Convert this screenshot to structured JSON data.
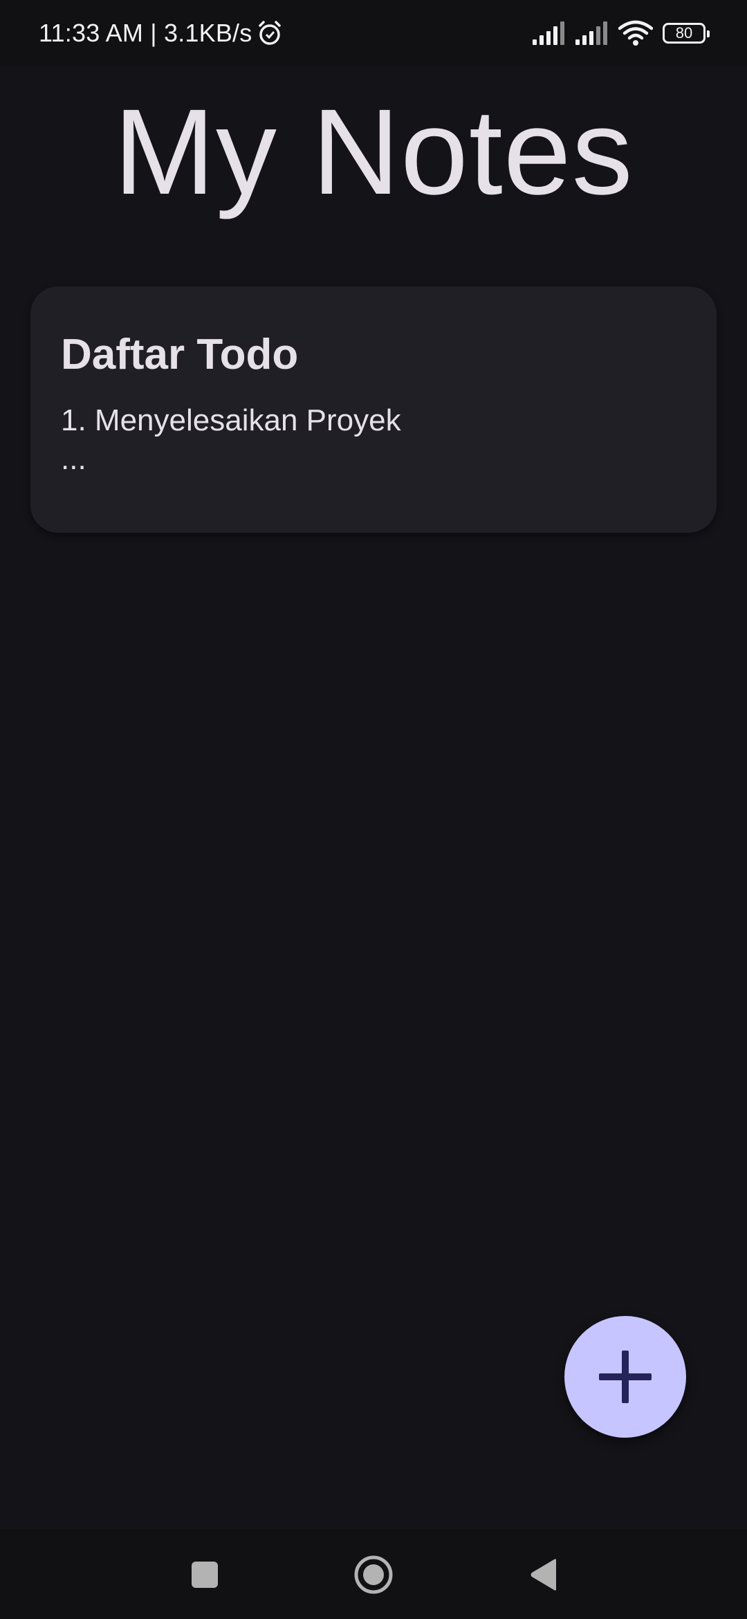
{
  "status_bar": {
    "time_speed": "11:33 AM | 3.1KB/s",
    "alarm_icon": "alarm-icon",
    "signal_icons": [
      "signal-icon",
      "signal-icon"
    ],
    "wifi_icon": "wifi-icon",
    "battery_level": "80"
  },
  "header": {
    "title": "My Notes"
  },
  "notes": [
    {
      "title": "Daftar Todo",
      "preview_line1": "1. Menyelesaikan Proyek",
      "preview_line2": "..."
    }
  ],
  "fab": {
    "icon": "plus-icon",
    "color": "#c7c5ff"
  },
  "nav_bar": {
    "items": [
      "recents-icon",
      "home-icon",
      "back-icon"
    ]
  },
  "colors": {
    "background": "#141318",
    "card": "#211f26",
    "text": "#e6e1e9",
    "fab_icon": "#24245a"
  }
}
